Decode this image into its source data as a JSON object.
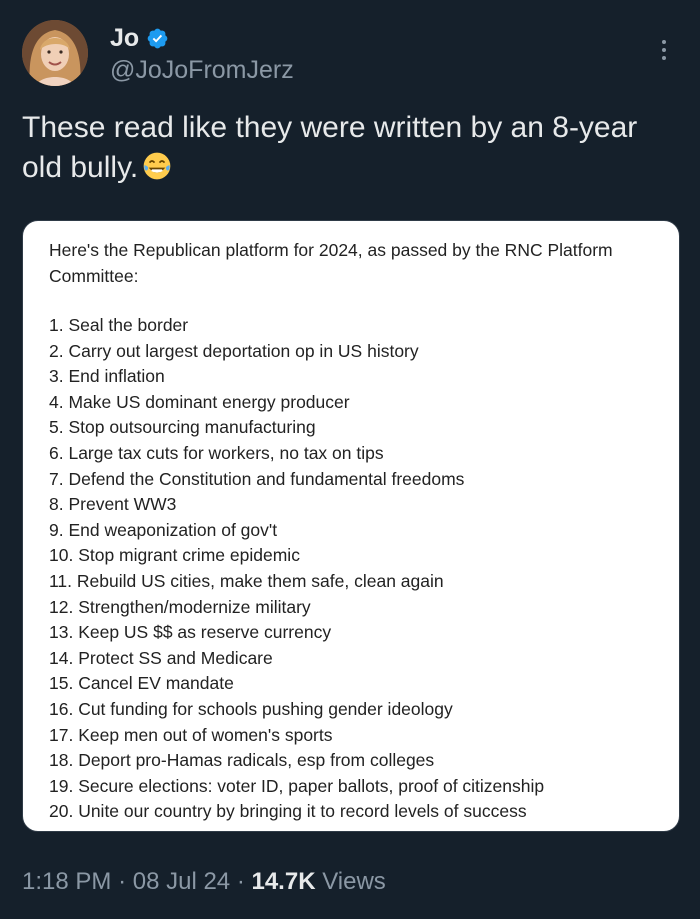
{
  "author": {
    "display_name": "Jo",
    "handle": "@JoJoFromJerz",
    "verified_icon": "verified-badge-icon",
    "avatar_icon": "profile-photo"
  },
  "tweet": {
    "text": "These read like they were written by an 8-year old bully.",
    "emoji_icon": "face-with-tears-of-joy-emoji"
  },
  "card": {
    "intro": "Here's the Republican platform for 2024, as passed by the RNC Platform Committee:",
    "items": [
      "1. Seal the border",
      "2. Carry out largest deportation op in US history",
      "3. End inflation",
      "4. Make US dominant energy producer",
      "5. Stop outsourcing manufacturing",
      "6. Large tax cuts for workers, no tax on tips",
      "7. Defend the Constitution and fundamental freedoms",
      "8. Prevent WW3",
      "9. End weaponization of gov't",
      "10. Stop migrant crime epidemic",
      "11. Rebuild US cities, make them safe, clean again",
      "12. Strengthen/modernize military",
      "13. Keep US $$ as reserve currency",
      "14. Protect SS and Medicare",
      "15. Cancel EV mandate",
      "16. Cut funding for schools pushing gender ideology",
      "17. Keep men out of women's sports",
      "18. Deport pro-Hamas radicals, esp from colleges",
      "19. Secure elections: voter ID, paper ballots, proof of citizenship",
      "20. Unite our country by bringing it to record levels of success"
    ]
  },
  "footer": {
    "time": "1:18 PM",
    "date": "08 Jul 24",
    "separator": "·",
    "views_count": "14.7K",
    "views_label": "Views"
  },
  "colors": {
    "background": "#15202b",
    "text_primary": "#e7e9ea",
    "text_secondary": "#8b98a5",
    "verified_blue": "#1d9bf0",
    "card_background": "#ffffff"
  }
}
